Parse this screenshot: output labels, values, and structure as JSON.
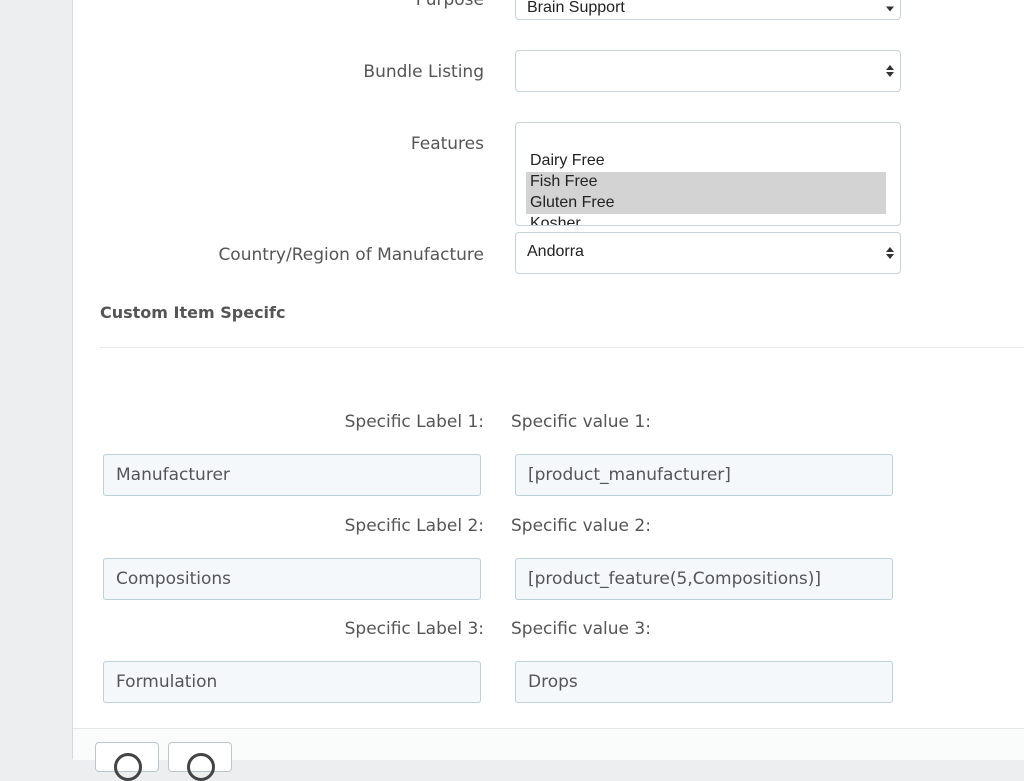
{
  "form": {
    "purpose": {
      "label": "Purpose",
      "value": "Brain Support"
    },
    "bundle_listing": {
      "label": "Bundle Listing",
      "value": ""
    },
    "features": {
      "label": "Features",
      "options": [
        {
          "label": "Dairy Free",
          "selected": false
        },
        {
          "label": "Fish Free",
          "selected": true
        },
        {
          "label": "Gluten Free",
          "selected": true
        },
        {
          "label": "Kosher",
          "selected": false
        }
      ]
    },
    "country": {
      "label": "Country/Region of Manufacture",
      "value": "Andorra"
    }
  },
  "custom_section": {
    "title": "Custom Item Specifc",
    "rows": [
      {
        "label_caption": "Specific Label 1:",
        "value_caption": "Specific value 1:",
        "label": "Manufacturer",
        "value": "[product_manufacturer]"
      },
      {
        "label_caption": "Specific Label 2:",
        "value_caption": "Specific value 2:",
        "label": "Compositions",
        "value": "[product_feature(5,Compositions)]"
      },
      {
        "label_caption": "Specific Label 3:",
        "value_caption": "Specific value 3:",
        "label": "Formulation",
        "value": "Drops"
      }
    ]
  },
  "colors": {
    "background": "#eceeef",
    "panel": "#ffffff",
    "input_fill": "#f4f8fa",
    "selected_option": "#d3d3d3"
  }
}
